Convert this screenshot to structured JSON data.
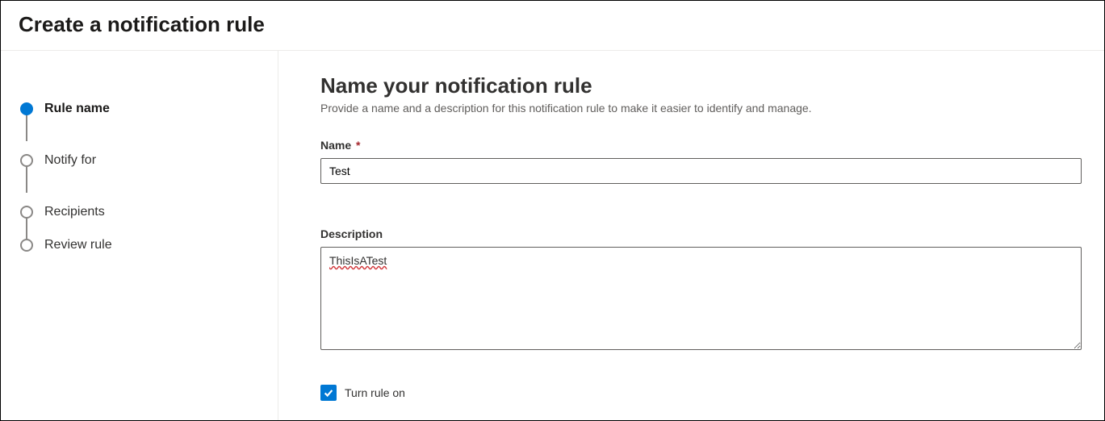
{
  "header": {
    "title": "Create a notification rule"
  },
  "sidebar": {
    "steps": [
      {
        "label": "Rule name",
        "active": true
      },
      {
        "label": "Notify for",
        "active": false
      },
      {
        "label": "Recipients",
        "active": false
      },
      {
        "label": "Review rule",
        "active": false
      }
    ]
  },
  "main": {
    "heading": "Name your notification rule",
    "subtitle": "Provide a name and a description for this notification rule to make it easier to identify and manage.",
    "name_field": {
      "label": "Name",
      "required_mark": "*",
      "value": "Test"
    },
    "description_field": {
      "label": "Description",
      "value": "ThisIsATest"
    },
    "turn_on": {
      "label": "Turn rule on",
      "checked": true
    }
  }
}
